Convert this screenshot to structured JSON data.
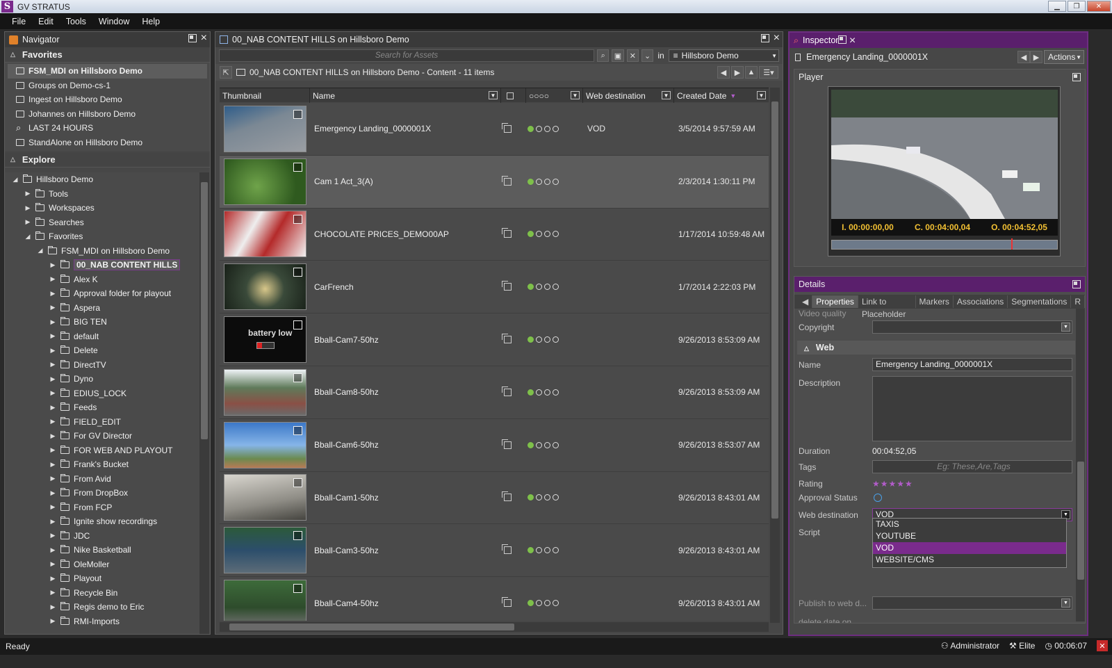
{
  "window": {
    "title": "GV STRATUS"
  },
  "menu": [
    "File",
    "Edit",
    "Tools",
    "Window",
    "Help"
  ],
  "navigator": {
    "title": "Navigator",
    "favorites_label": "Favorites",
    "favorites": [
      {
        "label": "FSM_MDI on Hillsboro Demo",
        "icon": "workspace-icon"
      },
      {
        "label": "Groups on Demo-cs-1",
        "icon": "folder-icon"
      },
      {
        "label": "Ingest on Hillsboro Demo",
        "icon": "folder-icon"
      },
      {
        "label": "Johannes on Hillsboro Demo",
        "icon": "folder-icon"
      },
      {
        "label": "LAST 24 HOURS",
        "icon": "search-icon"
      },
      {
        "label": "StandAlone on Hillsboro Demo",
        "icon": "workspace-icon"
      }
    ],
    "explore_label": "Explore",
    "tree": [
      {
        "label": "Hillsboro Demo",
        "level": 0,
        "open": true
      },
      {
        "label": "Tools",
        "level": 1
      },
      {
        "label": "Workspaces",
        "level": 1
      },
      {
        "label": "Searches",
        "level": 1
      },
      {
        "label": "Favorites",
        "level": 1,
        "open": true
      },
      {
        "label": "FSM_MDI on Hillsboro Demo",
        "level": 2,
        "open": true
      },
      {
        "label": "00_NAB CONTENT HILLS",
        "level": 3,
        "selected": true
      },
      {
        "label": "Alex K",
        "level": 3
      },
      {
        "label": "Approval folder for playout",
        "level": 3
      },
      {
        "label": "Aspera",
        "level": 3
      },
      {
        "label": "BIG TEN",
        "level": 3
      },
      {
        "label": "default",
        "level": 3
      },
      {
        "label": "Delete",
        "level": 3
      },
      {
        "label": "DirectTV",
        "level": 3
      },
      {
        "label": "Dyno",
        "level": 3
      },
      {
        "label": "EDIUS_LOCK",
        "level": 3
      },
      {
        "label": "Feeds",
        "level": 3
      },
      {
        "label": "FIELD_EDIT",
        "level": 3
      },
      {
        "label": "For GV Director",
        "level": 3
      },
      {
        "label": "FOR WEB AND PLAYOUT",
        "level": 3
      },
      {
        "label": "Frank's Bucket",
        "level": 3
      },
      {
        "label": "From Avid",
        "level": 3
      },
      {
        "label": "From DropBox",
        "level": 3
      },
      {
        "label": "From FCP",
        "level": 3
      },
      {
        "label": "Ignite show recordings",
        "level": 3
      },
      {
        "label": "JDC",
        "level": 3
      },
      {
        "label": "Nike Basketball",
        "level": 3
      },
      {
        "label": "OleMoller",
        "level": 3
      },
      {
        "label": "Playout",
        "level": 3
      },
      {
        "label": "Recycle Bin",
        "level": 3
      },
      {
        "label": "Regis demo to Eric",
        "level": 3
      },
      {
        "label": "RMI-Imports",
        "level": 3
      }
    ]
  },
  "content": {
    "title": "00_NAB CONTENT HILLS on Hillsboro Demo",
    "search_placeholder": "Search for Assets",
    "in_label": "in",
    "location": "Hillsboro Demo",
    "breadcrumb": "00_NAB CONTENT HILLS on Hillsboro Demo  -  Content  -  11 items",
    "columns": {
      "thumbnail": "Thumbnail",
      "name": "Name",
      "dots": "○○○○",
      "web": "Web destination",
      "created": "Created Date"
    },
    "rows": [
      {
        "name": "Emergency Landing_0000001X",
        "web": "VOD",
        "date": "3/5/2014 9:57:59 AM",
        "thumb": "race"
      },
      {
        "name": "Cam 1   Act_3(A)",
        "web": "",
        "date": "2/3/2014 1:30:11 PM",
        "thumb": "grass"
      },
      {
        "name": "CHOCOLATE PRICES_DEMO00AP",
        "web": "",
        "date": "1/17/2014 10:59:48 AM",
        "thumb": "football"
      },
      {
        "name": "CarFrench",
        "web": "",
        "date": "1/7/2014 2:22:03 PM",
        "thumb": "door"
      },
      {
        "name": "Bball-Cam7-50hz",
        "web": "",
        "date": "9/26/2013 8:53:09 AM",
        "thumb": "battery"
      },
      {
        "name": "Bball-Cam8-50hz",
        "web": "",
        "date": "9/26/2013 8:53:09 AM",
        "thumb": "court"
      },
      {
        "name": "Bball-Cam6-50hz",
        "web": "",
        "date": "9/26/2013 8:53:07 AM",
        "thumb": "sky"
      },
      {
        "name": "Bball-Cam1-50hz",
        "web": "",
        "date": "9/26/2013 8:43:01 AM",
        "thumb": "player"
      },
      {
        "name": "Bball-Cam3-50hz",
        "web": "",
        "date": "9/26/2013 8:43:01 AM",
        "thumb": "players"
      },
      {
        "name": "Bball-Cam4-50hz",
        "web": "",
        "date": "9/26/2013 8:43:01 AM",
        "thumb": "fence"
      }
    ],
    "battery_text": "battery low"
  },
  "inspector": {
    "title": "Inspector",
    "asset": "Emergency Landing_0000001X",
    "actions": "Actions",
    "player_label": "Player",
    "tc_in": "I.  00:00:00,00",
    "tc_cur": "C.  00:04:00,04",
    "tc_out": "O.  00:04:52,05",
    "details_label": "Details",
    "tabs": [
      "Properties",
      "Link to Placeholder",
      "Markers",
      "Associations",
      "Segmentations",
      "R"
    ],
    "video_quality_label": "Video quality",
    "copyright_label": "Copyright",
    "web_section": "Web",
    "name_label": "Name",
    "name_value": "Emergency Landing_0000001X",
    "description_label": "Description",
    "duration_label": "Duration",
    "duration_value": "00:04:52,05",
    "tags_label": "Tags",
    "tags_placeholder": "Eg: These,Are,Tags",
    "rating_label": "Rating",
    "approval_label": "Approval Status",
    "web_dest_label": "Web destination",
    "web_dest_value": "VOD",
    "script_label": "Script",
    "dropdown_options": [
      "TAXIS",
      "YOUTUBE",
      "VOD",
      "WEBSITE/CMS"
    ],
    "publish_label": "Publish to web d...",
    "delete_label": "delete date on..."
  },
  "status": {
    "left": "Ready",
    "user": "Administrator",
    "tier": "Elite",
    "time": "00:06:07"
  },
  "colors": {
    "accent": "#7a2b8c",
    "status_green": "#7ec04a",
    "timecode": "#f2c033"
  }
}
